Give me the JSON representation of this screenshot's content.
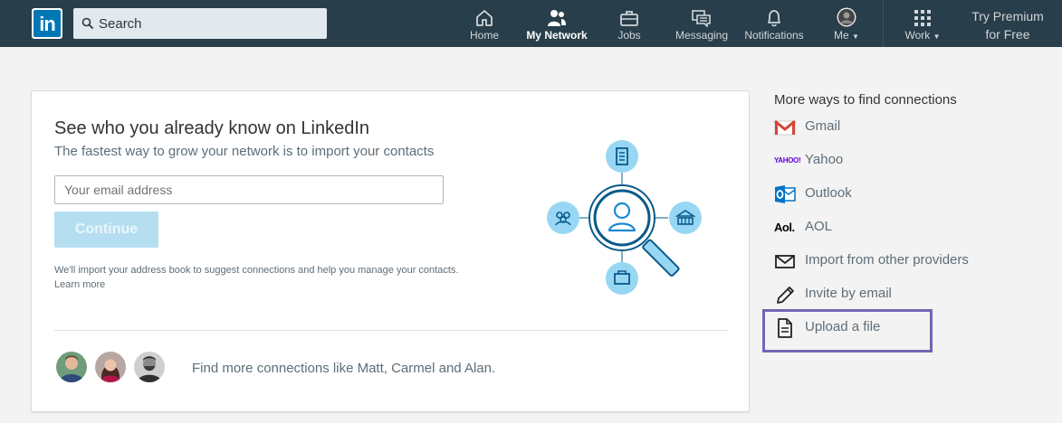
{
  "nav": {
    "logo": "in",
    "search_placeholder": "Search",
    "items": [
      {
        "label": "Home",
        "icon": "home-icon"
      },
      {
        "label": "My Network",
        "icon": "network-icon",
        "active": true
      },
      {
        "label": "Jobs",
        "icon": "briefcase-icon"
      },
      {
        "label": "Messaging",
        "icon": "messaging-icon"
      },
      {
        "label": "Notifications",
        "icon": "bell-icon"
      },
      {
        "label": "Me",
        "icon": "avatar"
      },
      {
        "label": "Work",
        "icon": "grid-icon"
      }
    ],
    "premium_line1": "Try Premium",
    "premium_line2": "for Free"
  },
  "import_card": {
    "title": "See who you already know on LinkedIn",
    "subtitle": "The fastest way to grow your network is to import your contacts",
    "email_placeholder": "Your email address",
    "continue_label": "Continue",
    "note": "We'll import your address book to suggest connections and help you manage your contacts.",
    "learn_more": "Learn more",
    "find_more": "Find more connections like Matt, Carmel and Alan."
  },
  "sidebar": {
    "title": "More ways to find connections",
    "providers": [
      {
        "label": "Gmail",
        "icon": "gmail-icon"
      },
      {
        "label": "Yahoo",
        "icon": "yahoo-icon",
        "logo_text": "YAHOO!"
      },
      {
        "label": "Outlook",
        "icon": "outlook-icon"
      },
      {
        "label": "AOL",
        "icon": "aol-icon",
        "logo_text": "Aol."
      },
      {
        "label": "Import from other providers",
        "icon": "envelope-icon"
      },
      {
        "label": "Invite by email",
        "icon": "pencil-icon"
      },
      {
        "label": "Upload a file",
        "icon": "file-icon"
      }
    ]
  },
  "colors": {
    "nav_bg": "#283e4a",
    "brand": "#0077b5",
    "continue_disabled": "#b5dff1",
    "highlight": "#6f67b3"
  }
}
